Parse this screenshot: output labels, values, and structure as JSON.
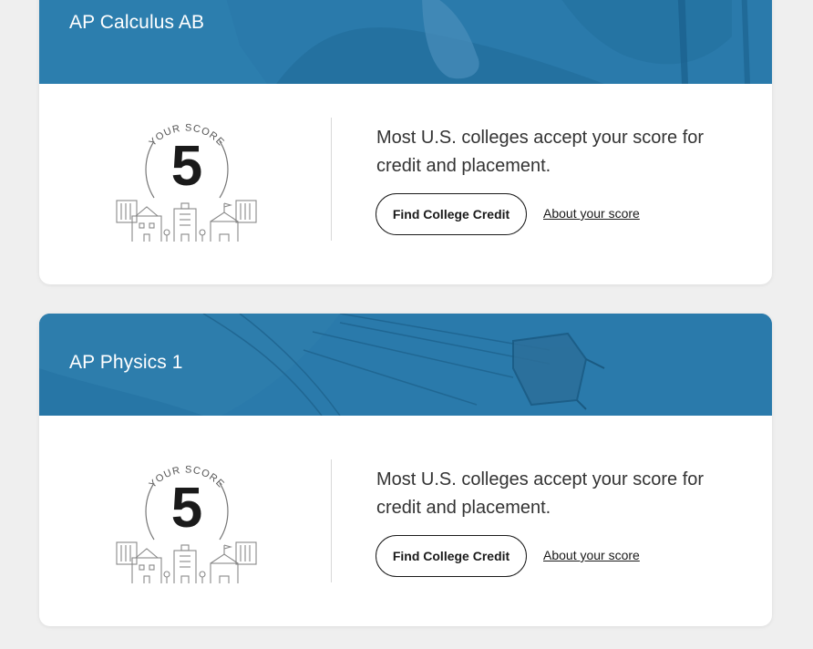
{
  "cards": [
    {
      "course_title": "AP Calculus AB",
      "score_label": "YOUR SCORE",
      "score": "5",
      "message": "Most U.S. colleges accept your score for credit and placement.",
      "cta_label": "Find College Credit",
      "link_label": "About your score"
    },
    {
      "course_title": "AP Physics 1",
      "score_label": "YOUR SCORE",
      "score": "5",
      "message": "Most U.S. colleges accept your score for credit and placement.",
      "cta_label": "Find College Credit",
      "link_label": "About your score"
    }
  ],
  "colors": {
    "banner": "#2a7aab",
    "page_background": "#efefef",
    "text_dark": "#1a1a1a"
  },
  "icons": [
    "buildings-illustration-icon",
    "score-arc-icon"
  ]
}
